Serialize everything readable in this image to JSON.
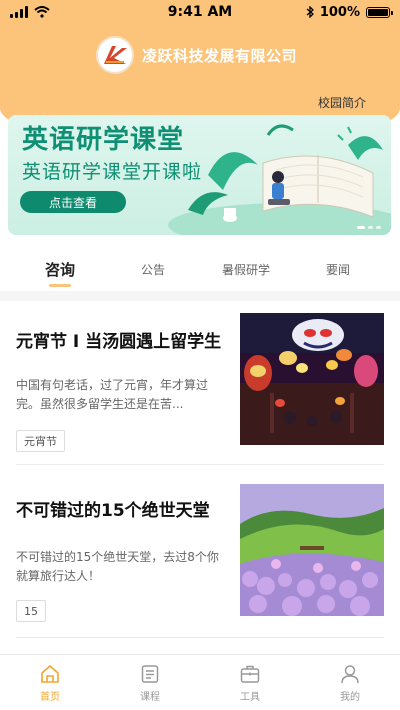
{
  "status_bar": {
    "time": "9:41 AM",
    "battery": "100%"
  },
  "header": {
    "company_name": "凌跃科技发展有限公司",
    "campus_link": "校园简介"
  },
  "banner": {
    "title": "英语研学课堂",
    "subtitle": "英语研学课堂开课啦",
    "button_label": "点击查看"
  },
  "tabs": [
    {
      "label": "咨询",
      "active": true
    },
    {
      "label": "公告",
      "active": false
    },
    {
      "label": "暑假研学",
      "active": false
    },
    {
      "label": "要闻",
      "active": false
    }
  ],
  "articles": [
    {
      "title": "元宵节 I 当汤圆遇上留学生",
      "summary": "中国有句老话，过了元宵，年才算过完。虽然很多留学生还是在苦...",
      "tag": "元宵节",
      "thumb_icon": "lantern-festival-image"
    },
    {
      "title": "不可错过的15个绝世天堂",
      "summary": "不可错过的15个绝世天堂，去过8个你就算旅行达人！",
      "tag": "15",
      "thumb_icon": "landscape-image"
    }
  ],
  "bottom_nav": [
    {
      "label": "首页",
      "icon": "home-icon",
      "active": true
    },
    {
      "label": "课程",
      "icon": "course-icon",
      "active": false
    },
    {
      "label": "工具",
      "icon": "toolbox-icon",
      "active": false
    },
    {
      "label": "我的",
      "icon": "profile-icon",
      "active": false
    }
  ],
  "colors": {
    "accent": "#fcc47a",
    "active_nav": "#f0a531",
    "banner_green": "#0f8f73"
  }
}
